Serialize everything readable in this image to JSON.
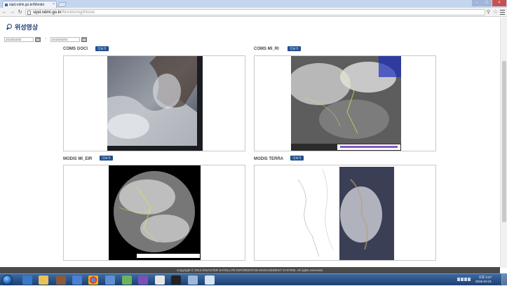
{
  "browser": {
    "tab_title": "sipd.ndmi.go.kr/Monito",
    "url_host": "sipd.ndmi.go.kr",
    "url_path": "/Monitoring/Movie"
  },
  "page": {
    "title": "위성영상"
  },
  "date_filter": {
    "start_date": "2015/02/02",
    "separator": "~",
    "end_date": "2015/02/04"
  },
  "panels": [
    {
      "label": "COMS GOCI",
      "button": "더보기"
    },
    {
      "label": "COMS MI_RI",
      "button": "더보기"
    },
    {
      "label": "MODIS MI_EIR",
      "button": "더보기"
    },
    {
      "label": "MODIS TERRA",
      "button": "더보기"
    }
  ],
  "footer": {
    "copyright": "Copyright © 2014 DISASTER SATELLITE INFORMATION MANAGEMENT SYSTEM. All rights reserved."
  },
  "taskbar": {
    "time": "오후 4:27",
    "date": "2015-10-21"
  },
  "colors": {
    "title": "#1b3c77",
    "button": "#1f4e8c",
    "footer_bg": "#4a4a4a",
    "taskbar": "#1f3f6e"
  }
}
